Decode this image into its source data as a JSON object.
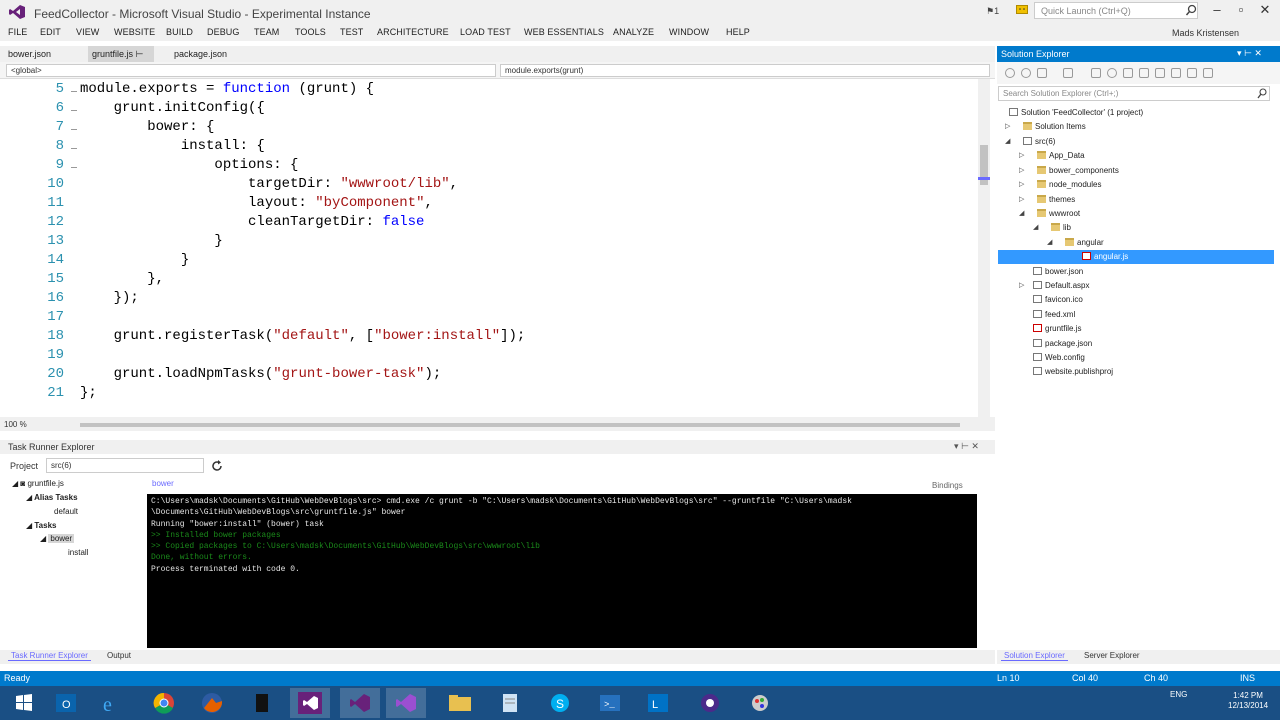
{
  "window": {
    "title": "FeedCollector - Microsoft Visual Studio - Experimental Instance",
    "notification_count": "1",
    "quick_launch_placeholder": "Quick Launch (Ctrl+Q)",
    "user": "Mads Kristensen"
  },
  "menu": [
    "FILE",
    "EDIT",
    "VIEW",
    "WEBSITE",
    "BUILD",
    "DEBUG",
    "TEAM",
    "TOOLS",
    "TEST",
    "ARCHITECTURE",
    "LOAD TEST",
    "WEB ESSENTIALS",
    "ANALYZE",
    "WINDOW",
    "HELP"
  ],
  "doc_tabs": [
    "bower.json",
    "gruntfile.js",
    "package.json"
  ],
  "nav": {
    "left": "<global>",
    "right": "module.exports(grunt)"
  },
  "editor": {
    "line_numbers": [
      "5",
      "6",
      "7",
      "8",
      "9",
      "10",
      "11",
      "12",
      "13",
      "14",
      "15",
      "16",
      "17",
      "18",
      "19",
      "20",
      "21"
    ],
    "zoom": "100 %"
  },
  "task_runner": {
    "title": "Task Runner Explorer",
    "project_label": "Project",
    "project_value": "src(6)",
    "tree": [
      "gruntfile.js",
      "Alias Tasks",
      "default",
      "Tasks",
      "bower",
      "install"
    ],
    "output_tab": "bower",
    "bindings": "Bindings",
    "console": [
      "C:\\Users\\madsk\\Documents\\GitHub\\WebDevBlogs\\src> cmd.exe /c grunt -b \"C:\\Users\\madsk\\Documents\\GitHub\\WebDevBlogs\\src\" --gruntfile \"C:\\Users\\madsk",
      "\\Documents\\GitHub\\WebDevBlogs\\src\\gruntfile.js\" bower",
      "Running \"bower:install\" (bower) task",
      ">> Installed bower packages",
      ">> Copied packages to C:\\Users\\madsk\\Documents\\GitHub\\WebDevBlogs\\src\\wwwroot\\lib",
      "",
      "Done, without errors.",
      "Process terminated with code 0."
    ]
  },
  "bottom_tabs": [
    "Task Runner Explorer",
    "Output"
  ],
  "solution_explorer": {
    "title": "Solution Explorer",
    "search_placeholder": "Search Solution Explorer (Ctrl+;)",
    "tree": [
      "Solution 'FeedCollector' (1 project)",
      "Solution Items",
      "src(6)",
      "App_Data",
      "bower_components",
      "node_modules",
      "themes",
      "wwwroot",
      "lib",
      "angular",
      "angular.js",
      "bower.json",
      "Default.aspx",
      "favicon.ico",
      "feed.xml",
      "gruntfile.js",
      "package.json",
      "Web.config",
      "website.publishproj"
    ],
    "tabs": [
      "Solution Explorer",
      "Server Explorer"
    ]
  },
  "status": {
    "ready": "Ready",
    "ln": "Ln 10",
    "col": "Col 40",
    "ch": "Ch 40",
    "ins": "INS"
  },
  "taskbar": {
    "apps": [
      "start-button",
      "outlook",
      "internet-explorer",
      "chrome",
      "firefox",
      "terminal",
      "visual-studio",
      "visual-studio",
      "visual-studio",
      "file-explorer",
      "notepad",
      "skype",
      "powershell",
      "lync",
      "media",
      "paint"
    ],
    "tray_lang": "ENG",
    "time": "1:42 PM",
    "date": "12/13/2014"
  },
  "colors": {
    "accent": "#007acc",
    "keyword": "#0000ff",
    "string": "#a31515",
    "line_number": "#2b91af",
    "selection": "#3399ff"
  }
}
